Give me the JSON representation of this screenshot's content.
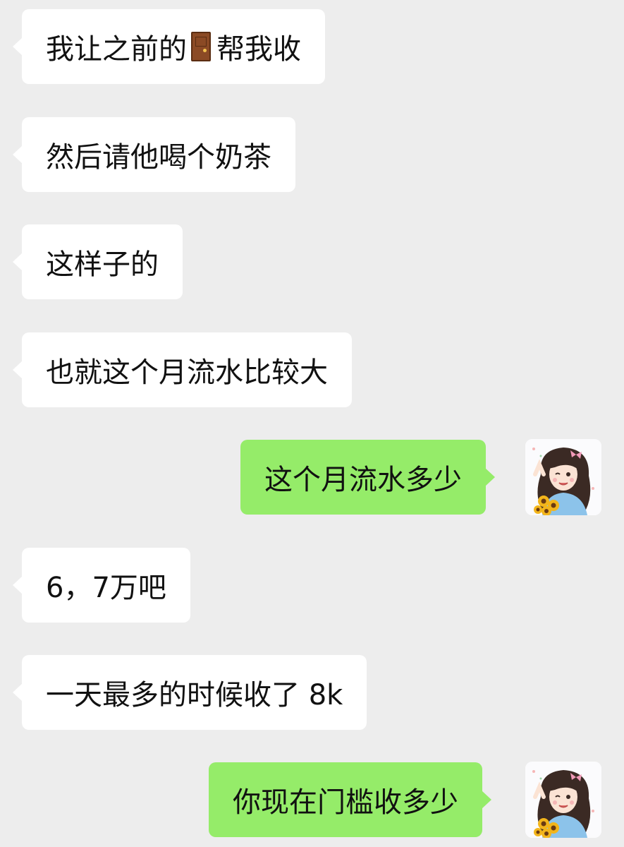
{
  "messages": [
    {
      "side": "in",
      "text_before": "我让之前的",
      "icon": "door-icon",
      "text_after": "帮我收"
    },
    {
      "side": "in",
      "text": "然后请他喝个奶茶"
    },
    {
      "side": "in",
      "text": "这样子的"
    },
    {
      "side": "in",
      "text": "也就这个月流水比较大"
    },
    {
      "side": "out",
      "text": "这个月流水多少"
    },
    {
      "side": "in",
      "text": "6，7万吧"
    },
    {
      "side": "in",
      "text": "一天最多的时候收了 8k"
    },
    {
      "side": "out",
      "text": "你现在门槛收多少"
    }
  ],
  "avatar": {
    "icon": "girl-with-sunflowers-avatar"
  },
  "colors": {
    "background": "#ededed",
    "incoming_bubble": "#ffffff",
    "outgoing_bubble": "#95ec69",
    "text": "#111111"
  }
}
